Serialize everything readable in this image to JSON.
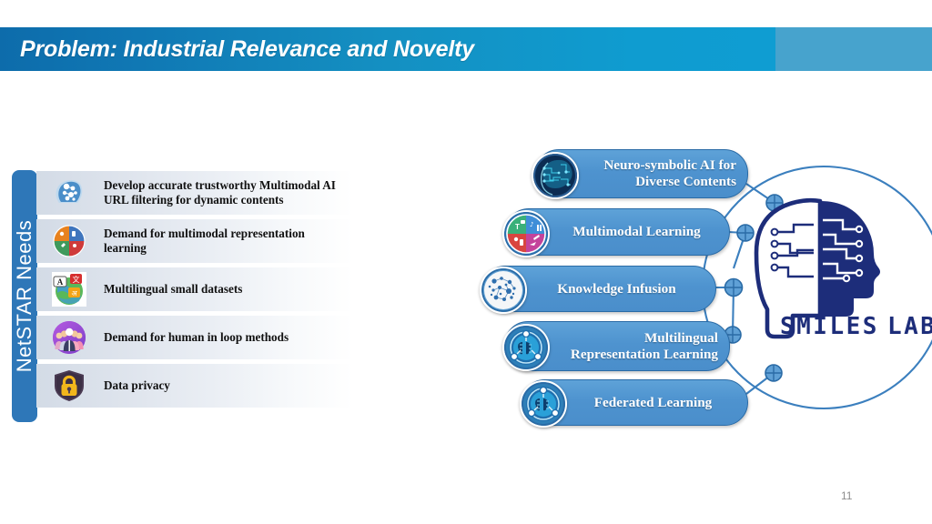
{
  "slide": {
    "title": "Problem: Industrial Relevance and Novelty",
    "page_number": "11",
    "colors": {
      "title_bar_left": "#0d6cab",
      "title_bar_right": "#0f9dd2",
      "title_bar_flat": "#47a3cd",
      "sidebar_blue": "#2e77b8",
      "pill_blue": "#4e93cf",
      "pill_border": "#2a6ba6",
      "logo_navy": "#1d2d7a",
      "connector_blue": "#3b7fbe"
    }
  },
  "sidebar": {
    "label": "NetSTAR Needs"
  },
  "needs": {
    "items": [
      {
        "text": "Develop accurate trustworthy Multimodal AI URL filtering for dynamic contents",
        "icon": "head-gears-icon"
      },
      {
        "text": "Demand for multimodal representation learning",
        "icon": "multimodal-wheel-icon"
      },
      {
        "text": "Multilingual small datasets",
        "icon": "translate-globe-icon"
      },
      {
        "text": "Demand for human in loop methods",
        "icon": "people-group-icon"
      },
      {
        "text": "Data privacy",
        "icon": "lock-shield-icon"
      }
    ]
  },
  "mindmap": {
    "center_logo": {
      "name": "smiles-lab-logo",
      "word_left": "SMILES",
      "word_right": "LAB"
    },
    "nodes": [
      {
        "label": "Neuro-symbolic AI for Diverse Contents",
        "icon": "circuit-head-icon",
        "align": "right"
      },
      {
        "label": "Multimodal Learning",
        "icon": "multimodal-wheel-icon",
        "align": "center"
      },
      {
        "label": "Knowledge Infusion",
        "icon": "molecule-dots-icon",
        "align": "center"
      },
      {
        "label": "Multilingual Representation Learning",
        "icon": "federated-brain-icon",
        "align": "right"
      },
      {
        "label": "Federated Learning",
        "icon": "federated-brain-icon",
        "align": "center"
      }
    ]
  }
}
